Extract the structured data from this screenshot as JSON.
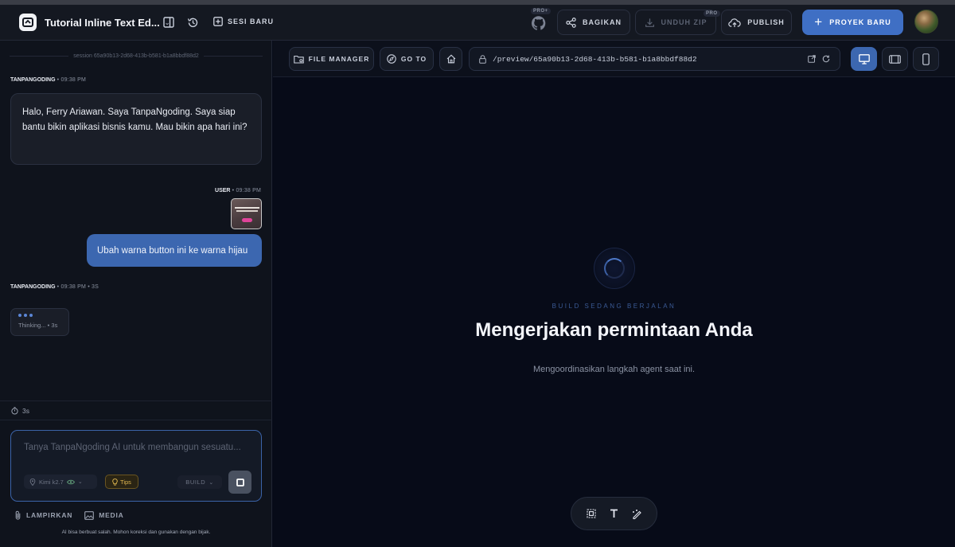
{
  "topbar": {
    "project_title": "Tutorial Inline Text Ed...",
    "new_session_label": "SESI BARU",
    "github_pro_badge": "PRO+",
    "share_label": "BAGIKAN",
    "download_zip_label": "UNDUH ZIP",
    "download_pro_badge": "PRO",
    "publish_label": "PUBLISH",
    "new_project_label": "PROYEK BARU"
  },
  "chat": {
    "session_id": "session 65a90b13-2d68-413b-b581-b1a8bbdf88d2",
    "messages": [
      {
        "sender": "TANPANGODING",
        "time": "09:38 PM",
        "text": "Halo, Ferry Ariawan. Saya TanpaNgoding. Saya siap bantu bikin aplikasi bisnis kamu. Mau bikin apa hari ini?"
      },
      {
        "sender": "USER",
        "time": "09:38 PM",
        "text": "Ubah warna button ini ke warna hijau"
      },
      {
        "sender": "TANPANGODING",
        "time": "09:38 PM",
        "duration": "3S"
      }
    ],
    "thinking_text": "Thinking... • 3s",
    "timer": "3s"
  },
  "composer": {
    "placeholder": "Tanya TanpaNgoding AI untuk membangun sesuatu...",
    "model": "Kimi k2.7",
    "tips_label": "Tips",
    "mode": "BUILD",
    "attach_label": "LAMPIRKAN",
    "media_label": "MEDIA",
    "disclaimer": "AI bisa berbuat salah. Mohon koreksi dan gunakan dengan bijak."
  },
  "preview": {
    "file_manager_label": "FILE MANAGER",
    "goto_label": "GO TO",
    "url": "/preview/65a90b13-2d68-413b-b581-b1a8bbdf88d2",
    "active_view": "desktop",
    "status_label": "BUILD SEDANG BERJALAN",
    "status_title": "Mengerjakan permintaan Anda",
    "status_subtitle": "Mengoordinasikan langkah agent saat ini."
  },
  "colors": {
    "accent": "#3f6fc4",
    "background": "#070b18",
    "panel": "#0f131c",
    "tips": "#e0b850"
  }
}
